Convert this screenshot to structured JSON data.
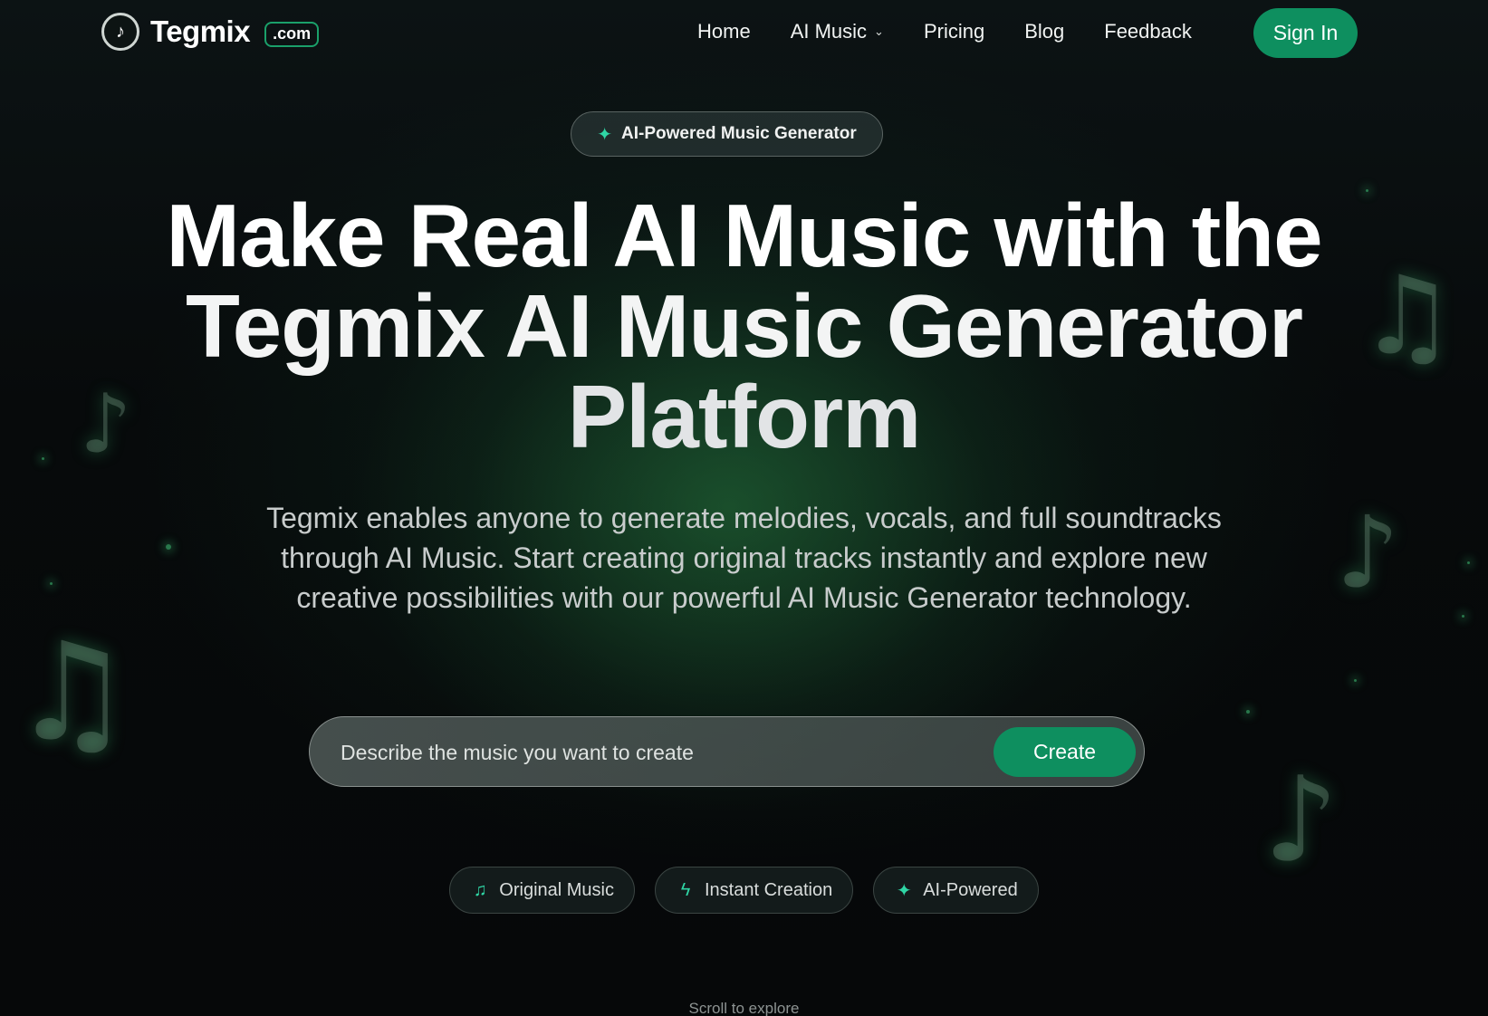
{
  "brand": {
    "name": "Tegmix",
    "domain": ".com",
    "logo_icon": "music-note-icon"
  },
  "nav": {
    "items": [
      {
        "label": "Home"
      },
      {
        "label": "AI Music",
        "has_dropdown": true,
        "dropdown_icon": "chevron-down-icon"
      },
      {
        "label": "Pricing"
      },
      {
        "label": "Blog"
      },
      {
        "label": "Feedback"
      }
    ],
    "sign_in": "Sign In"
  },
  "hero": {
    "badge": {
      "icon": "sparkle-icon",
      "label": "AI-Powered Music Generator"
    },
    "headline": {
      "line1": "Make Real AI Music with the",
      "line2": "Tegmix AI Music Generator",
      "line3": "Platform"
    },
    "subtitle": "Tegmix enables anyone to generate melodies, vocals, and full soundtracks through AI Music. Start creating original tracks instantly and explore new creative possibilities with our powerful AI Music Generator technology.",
    "prompt": {
      "placeholder": "Describe the music you want to create",
      "value": "",
      "button": "Create"
    },
    "features": [
      {
        "icon": "music-note-icon",
        "label": "Original Music"
      },
      {
        "icon": "lightning-icon",
        "label": "Instant Creation"
      },
      {
        "icon": "sparkle-icon",
        "label": "AI-Powered"
      }
    ],
    "scroll_hint": "Scroll to explore"
  },
  "colors": {
    "accent": "#0e8f5f",
    "icon_accent": "#2fd6a5",
    "background": "#07090b"
  }
}
